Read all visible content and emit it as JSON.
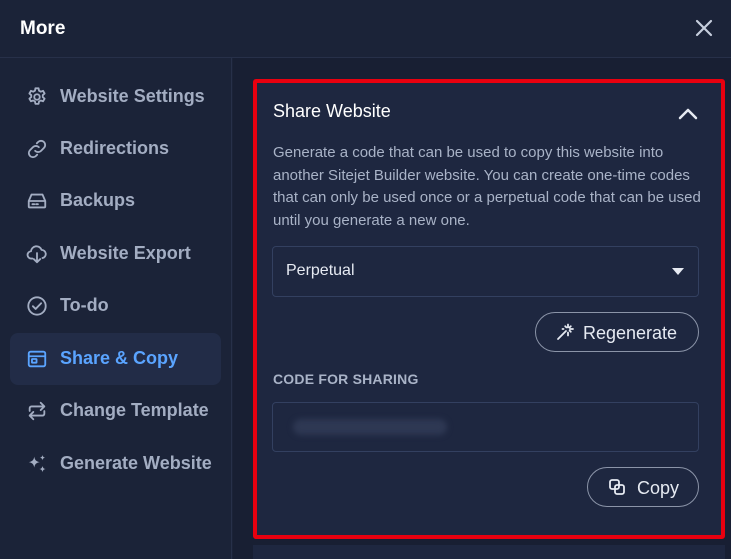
{
  "header": {
    "title": "More"
  },
  "sidebar": {
    "items": [
      {
        "label": "Website Settings",
        "icon": "gear-icon"
      },
      {
        "label": "Redirections",
        "icon": "link-icon"
      },
      {
        "label": "Backups",
        "icon": "drive-icon"
      },
      {
        "label": "Website Export",
        "icon": "cloud-download-icon"
      },
      {
        "label": "To-do",
        "icon": "check-circle-icon"
      },
      {
        "label": "Share & Copy",
        "icon": "window-icon",
        "active": true
      },
      {
        "label": "Change Template",
        "icon": "swap-arrows-icon"
      },
      {
        "label": "Generate Website",
        "icon": "sparkles-icon"
      }
    ]
  },
  "share": {
    "title": "Share Website",
    "description": "Generate a code that can be used to copy this website into another Sitejet Builder website. You can create one-time codes that can only be used once or a perpetual code that can be used until you generate a new one.",
    "mode_value": "Perpetual",
    "regenerate_label": "Regenerate",
    "code_label": "CODE FOR SHARING",
    "copy_label": "Copy"
  },
  "colors": {
    "accent": "#5aa4ff",
    "highlight_border": "#e8000f",
    "background": "#1b2338"
  }
}
